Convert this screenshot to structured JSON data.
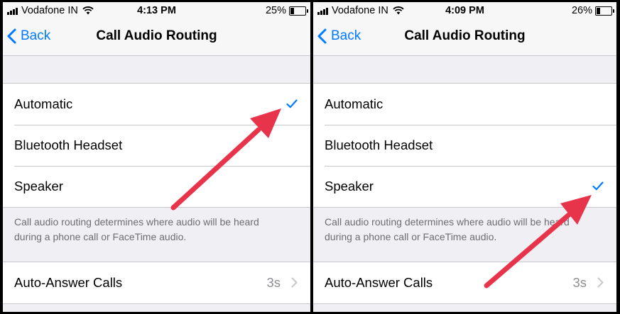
{
  "screens": [
    {
      "status": {
        "carrier": "Vodafone IN",
        "time": "4:13 PM",
        "battery_text": "25%",
        "battery_level": 0.25
      },
      "nav": {
        "back_label": "Back",
        "title": "Call Audio Routing"
      },
      "options": [
        {
          "label": "Automatic",
          "selected": true
        },
        {
          "label": "Bluetooth Headset",
          "selected": false
        },
        {
          "label": "Speaker",
          "selected": false
        }
      ],
      "footer": [
        "Call audio routing determines where audio will be heard",
        "during a phone call or FaceTime audio."
      ],
      "auto_answer": {
        "label": "Auto-Answer Calls",
        "value": "3s"
      }
    },
    {
      "status": {
        "carrier": "Vodafone IN",
        "time": "4:09 PM",
        "battery_text": "26%",
        "battery_level": 0.26
      },
      "nav": {
        "back_label": "Back",
        "title": "Call Audio Routing"
      },
      "options": [
        {
          "label": "Automatic",
          "selected": false
        },
        {
          "label": "Bluetooth Headset",
          "selected": false
        },
        {
          "label": "Speaker",
          "selected": true
        }
      ],
      "footer": [
        "Call audio routing determines where audio will be heard",
        "during a phone call or FaceTime audio."
      ],
      "auto_answer": {
        "label": "Auto-Answer Calls",
        "value": "3s"
      }
    }
  ],
  "colors": {
    "accent": "#007aff",
    "annotation_arrow": "#e8344b",
    "background": "#efeff4",
    "secondary_text": "#8e8e93"
  },
  "icons": {
    "back": "chevron-left-icon",
    "selected": "checkmark-icon",
    "disclosure": "chevron-right-icon",
    "wifi": "wifi-icon",
    "signal": "signal-bars-icon",
    "battery": "battery-icon"
  }
}
